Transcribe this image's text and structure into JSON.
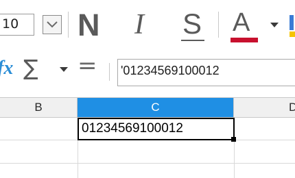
{
  "toolbar": {
    "font_size": "10",
    "bold_label": "N",
    "italic_label": "I",
    "strikethrough_label": "S",
    "font_color_label": "A",
    "font_color_value": "#c8102e"
  },
  "formula_bar": {
    "function_wizard_label": "fx",
    "sum_label": "∑",
    "equals_label": "=",
    "input_value": "'01234569100012"
  },
  "columns": [
    {
      "label": "B",
      "selected": false
    },
    {
      "label": "C",
      "selected": true
    },
    {
      "label": "D",
      "selected": false
    }
  ],
  "sheet": {
    "active_cell_value": "01234569100012"
  },
  "colors": {
    "selected_header": "#1f8fe4",
    "function_icon": "#2a8dd6"
  }
}
